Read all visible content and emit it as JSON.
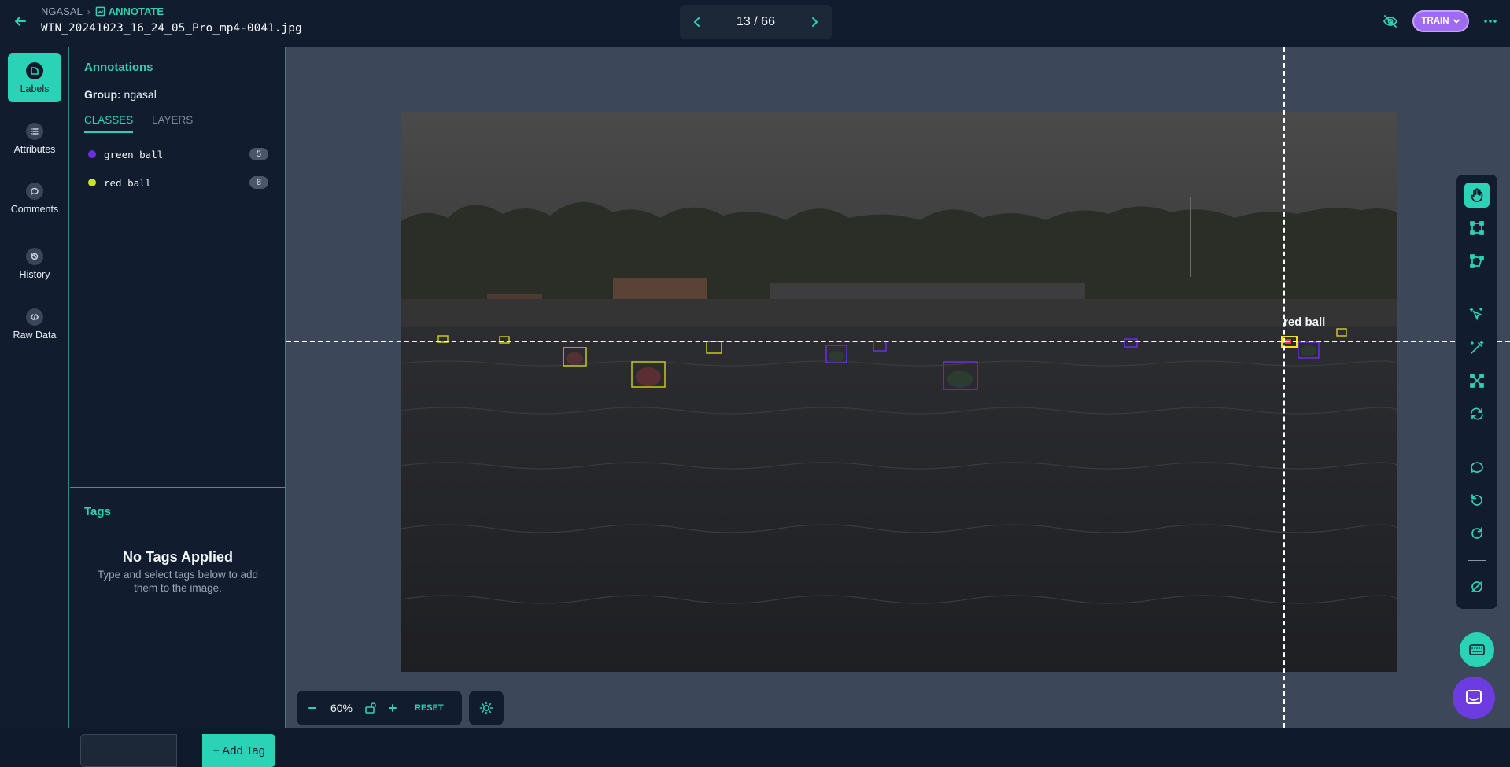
{
  "header": {
    "project": "NGASAL",
    "mode": "ANNOTATE",
    "filename": "WIN_20241023_16_24_05_Pro_mp4-0041.jpg",
    "pager": "13 / 66",
    "train_label": "TRAIN"
  },
  "rail": {
    "items": [
      {
        "label": "Labels",
        "icon": "tag-icon",
        "active": true
      },
      {
        "label": "Attributes",
        "icon": "list-icon"
      },
      {
        "label": "Comments",
        "icon": "comment-icon"
      },
      {
        "label": "History",
        "icon": "history-icon"
      },
      {
        "label": "Raw Data",
        "icon": "code-icon"
      }
    ]
  },
  "panel": {
    "title": "Annotations",
    "group_label": "Group:",
    "group_value": "ngasal",
    "tabs": [
      "CLASSES",
      "LAYERS"
    ],
    "classes": [
      {
        "name": "green ball",
        "count": "5",
        "color": "#6b2ee0"
      },
      {
        "name": "red ball",
        "count": "8",
        "color": "#c8e61a"
      }
    ]
  },
  "tags": {
    "title": "Tags",
    "empty_title": "No Tags Applied",
    "empty_desc": "Type and select tags below to add them to the image.",
    "input_value": "",
    "add_label": "+ Add Tag"
  },
  "canvas": {
    "cursor_label": "red ball",
    "box_colors": {
      "green ball": "#6b2ee0",
      "red ball": "#c8c81a",
      "selected": "#f5e11a"
    }
  },
  "tools": [
    "hand-icon",
    "bbox-icon",
    "polygon-icon",
    "smart-select-icon",
    "magic-wand-icon",
    "keypoints-icon",
    "sync-icon",
    "comment-icon",
    "undo-icon",
    "redo-icon",
    "clear-icon"
  ],
  "zoom": {
    "value": "60%",
    "reset_label": "RESET"
  },
  "colors": {
    "accent": "#2ad3b6",
    "train": "#9f6bf0",
    "chat": "#6c3ce0"
  }
}
